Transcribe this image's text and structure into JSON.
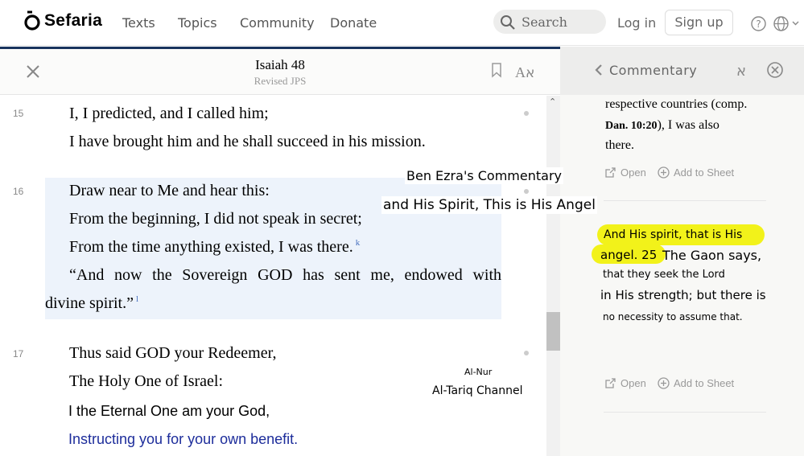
{
  "nav": {
    "logo": "Sefaria",
    "links": [
      "Texts",
      "Topics",
      "Community",
      "Donate"
    ],
    "search_placeholder": "Search",
    "login": "Log in",
    "signup": "Sign up"
  },
  "reader": {
    "title": "Isaiah 48",
    "version": "Revised JPS",
    "verses": [
      {
        "num": "15",
        "lines": [
          "I, I predicted, and I called him;",
          "I have brought him and he shall succeed in his mission."
        ]
      },
      {
        "num": "16",
        "lines": [
          "Draw near to Me and hear this:",
          "From the beginning, I did not speak in secret;",
          "From the time anything existed, I was there.",
          "“And now the Sovereign GOD has sent me, endowed with",
          "divine spirit.”"
        ],
        "footnotes": [
          "k",
          "l"
        ]
      },
      {
        "num": "17",
        "lines": [
          "Thus said GOD your Redeemer,",
          "The Holy One of Israel:",
          "I the Eternal One am your God,",
          "Instructing you for your own benefit."
        ]
      }
    ]
  },
  "overlays": {
    "commentary_name": "Ben Ezra's Commentary",
    "subtitle": "and His Spirit, This is His Angel",
    "channel_small": "Al-Nur",
    "channel": "Al-Tariq Channel"
  },
  "panel": {
    "title": "Commentary",
    "entry1": {
      "line1": "respective countries (comp.",
      "ref": "Dan. 10:20",
      "line2_rest": "), I was also",
      "line3": "there."
    },
    "open": "Open",
    "add_to_sheet": "Add to Sheet",
    "entry2": {
      "hl1": "And His spirit, that is His",
      "hl2": "angel. 25",
      "rest1": "The Gaon says,",
      "line2": "that they seek the Lord",
      "line3": "in His strength; but there is",
      "line4": "no necessity to assume that."
    }
  },
  "colors": {
    "accent_navy": "#18345d",
    "verse_highlight": "#edf3fb",
    "comment_highlight": "#f2f21a",
    "link_blue": "#1d2d9b"
  }
}
